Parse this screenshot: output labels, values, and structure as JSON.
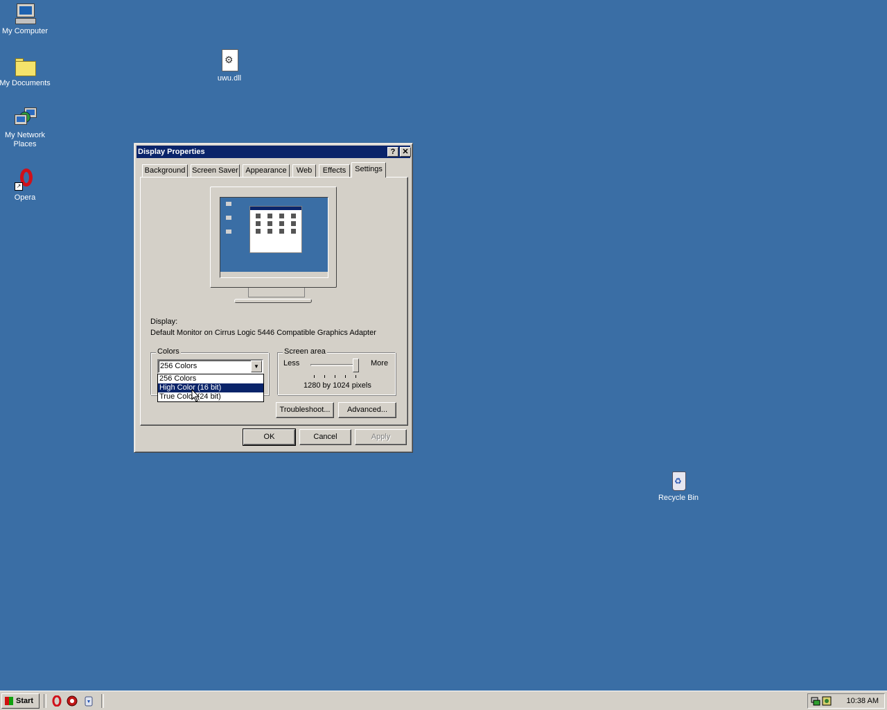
{
  "desktop": {
    "icons": [
      {
        "label": "My Computer",
        "icon": "computer-icon"
      },
      {
        "label": "My Documents",
        "icon": "folder-icon"
      },
      {
        "label": "My Network Places",
        "icon": "network-icon"
      },
      {
        "label": "Opera",
        "icon": "opera-icon"
      },
      {
        "label": "uwu.dll",
        "icon": "dll-file-icon"
      },
      {
        "label": "Recycle Bin",
        "icon": "recycle-bin-icon"
      }
    ],
    "background_color": "#3a6ea5"
  },
  "window": {
    "title": "Display Properties",
    "help_button": "?",
    "close_button": "✕",
    "tabs": [
      {
        "label": "Background"
      },
      {
        "label": "Screen Saver"
      },
      {
        "label": "Appearance"
      },
      {
        "label": "Web"
      },
      {
        "label": "Effects"
      },
      {
        "label": "Settings",
        "active": true
      }
    ],
    "display_label": "Display:",
    "display_value": "Default Monitor on Cirrus Logic 5446 Compatible Graphics Adapter",
    "colors": {
      "legend": "Colors",
      "selected": "256 Colors",
      "options": [
        "256 Colors",
        "High Color (16 bit)",
        "True Color (24 bit)"
      ],
      "highlighted_option": "High Color (16 bit)"
    },
    "screen_area": {
      "legend": "Screen area",
      "less_label": "Less",
      "more_label": "More",
      "value_text": "1280 by 1024 pixels",
      "slider_position": 1.0
    },
    "buttons": {
      "troubleshoot": "Troubleshoot...",
      "advanced": "Advanced...",
      "ok": "OK",
      "cancel": "Cancel",
      "apply": "Apply"
    },
    "title_color": "#0a246a"
  },
  "taskbar": {
    "start_label": "Start",
    "clock": "10:38 AM",
    "quick_launch": [
      "opera-icon",
      "browser-icon",
      "recycle-icon"
    ],
    "tray_icons": [
      "network-tray-icon",
      "security-tray-icon"
    ]
  }
}
